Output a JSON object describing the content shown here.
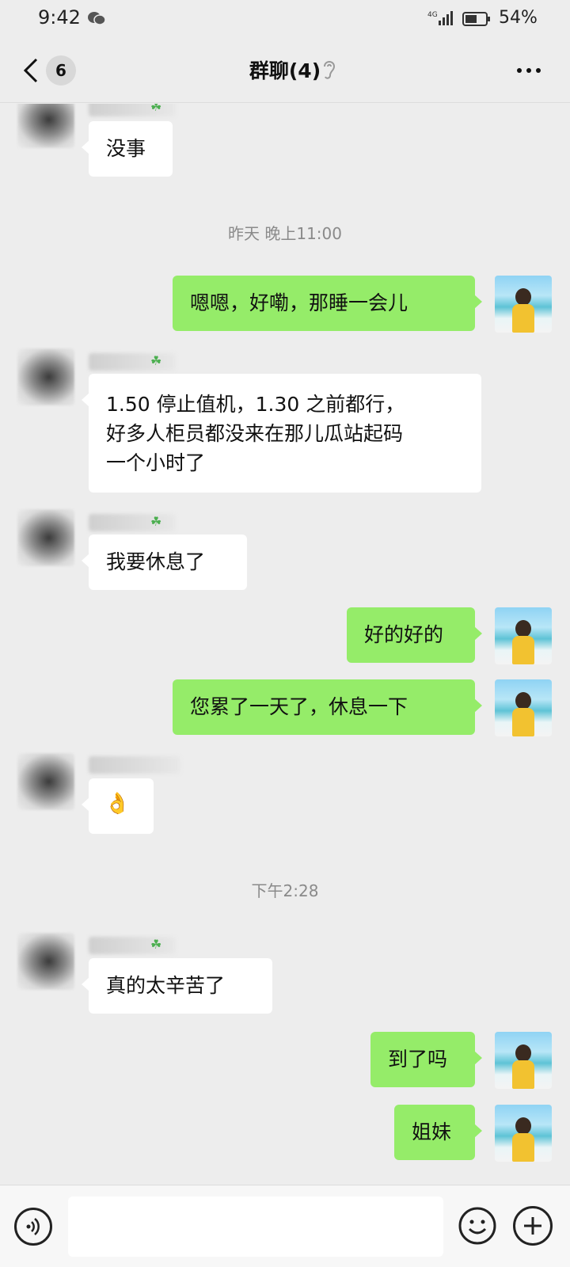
{
  "status_bar": {
    "time": "9:42",
    "network": "4G",
    "battery": "54%"
  },
  "header": {
    "unread_count": "6",
    "title": "群聊(4)"
  },
  "messages": [
    {
      "side": "other",
      "text": "没事"
    },
    {
      "type": "timestamp",
      "text": "昨天 晚上11:00"
    },
    {
      "side": "me",
      "text": "嗯嗯，好嘞，那睡一会儿"
    },
    {
      "side": "other",
      "lines": [
        "1.50 停止值机，1.30 之前都行，",
        "好多人柜员都没来在那儿瓜站起码",
        "一个小时了"
      ]
    },
    {
      "side": "other",
      "text": "我要休息了"
    },
    {
      "side": "me",
      "text": "好的好的"
    },
    {
      "side": "me",
      "text": "您累了一天了，休息一下"
    },
    {
      "side": "other",
      "text": "👌"
    },
    {
      "type": "timestamp",
      "text": "下午2:28"
    },
    {
      "side": "other",
      "text": "真的太辛苦了"
    },
    {
      "side": "me",
      "text": "到了吗"
    },
    {
      "side": "me",
      "text": "姐妹"
    }
  ],
  "input": {
    "value": ""
  },
  "icons": {
    "back": "chevron-left-icon",
    "mute": "ear-icon",
    "more": "ellipsis-icon",
    "voice": "voice-icon",
    "emoji": "emoji-icon",
    "plus": "plus-icon"
  },
  "colors": {
    "background": "#ededed",
    "my_bubble": "#95ec69",
    "other_bubble": "#ffffff",
    "timestamp": "#8a8a8a"
  }
}
